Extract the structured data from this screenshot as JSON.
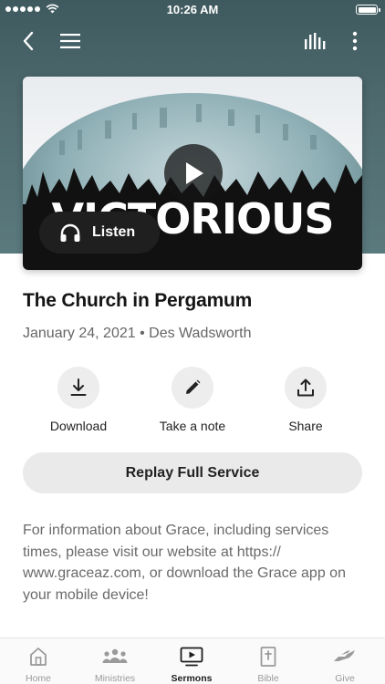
{
  "status_bar": {
    "time": "10:26 AM"
  },
  "sermon": {
    "artwork_title": "VICTORIOUS",
    "listen_label": "Listen",
    "title": "The Church in Pergamum",
    "meta": "January 24, 2021 • Des Wadsworth"
  },
  "actions": [
    {
      "label": "Download",
      "icon": "download-icon"
    },
    {
      "label": "Take a note",
      "icon": "pencil-icon"
    },
    {
      "label": "Share",
      "icon": "share-icon"
    }
  ],
  "replay_label": "Replay Full Service",
  "info_text": "For information about Grace, including services times, please visit our website at https:// www.graceaz.com, or download the Grace app on your mobile device!",
  "tabs": [
    {
      "label": "Home",
      "icon": "home-icon",
      "active": false
    },
    {
      "label": "Ministries",
      "icon": "group-icon",
      "active": false
    },
    {
      "label": "Sermons",
      "icon": "tv-play-icon",
      "active": true
    },
    {
      "label": "Bible",
      "icon": "bible-icon",
      "active": false
    },
    {
      "label": "Give",
      "icon": "giving-hand-icon",
      "active": false
    }
  ],
  "colors": {
    "header_bg": "#4f6b70",
    "active_tab": "#1e1e1e",
    "inactive_tab": "#9a9a9a"
  }
}
